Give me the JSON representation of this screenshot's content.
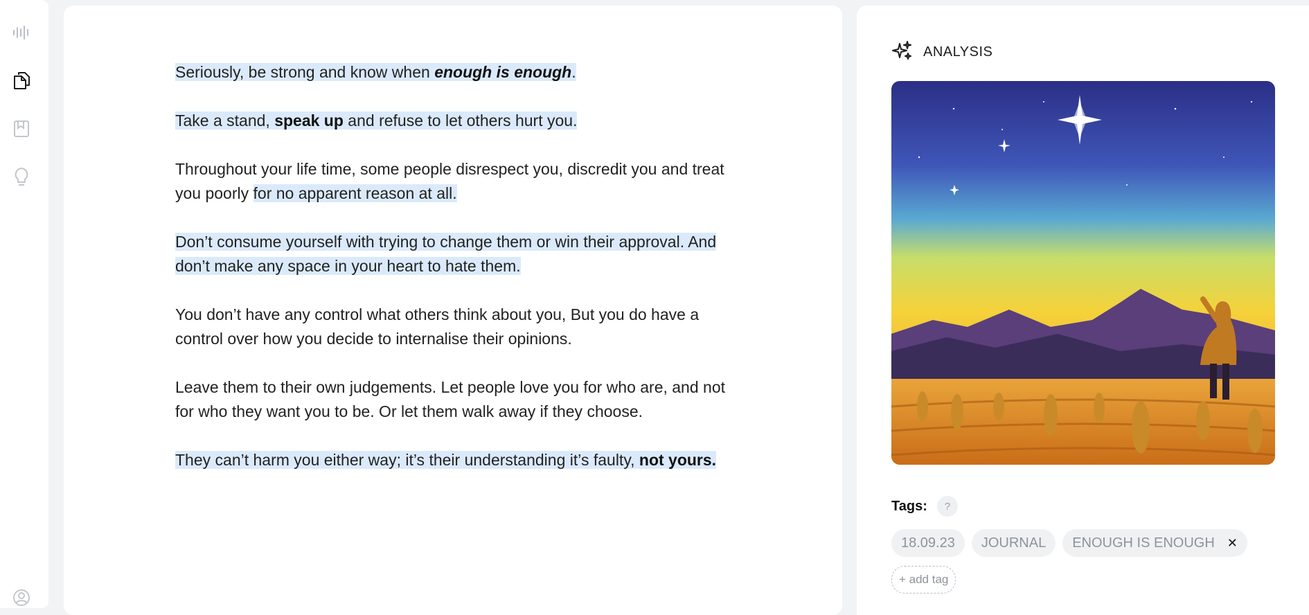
{
  "rail": {
    "icons": [
      "waveform-icon",
      "documents-icon",
      "bookmark-icon",
      "lightbulb-icon",
      "profile-icon"
    ]
  },
  "document": {
    "paragraphs": [
      {
        "highlight": true,
        "segments": [
          {
            "text": "Seriously, be strong and know when ",
            "style": "normal"
          },
          {
            "text": "enough is enough",
            "style": "bold-italic"
          },
          {
            "text": ".",
            "style": "normal"
          }
        ]
      },
      {
        "highlight": true,
        "segments": [
          {
            "text": "Take a stand, ",
            "style": "normal"
          },
          {
            "text": "speak up",
            "style": "bold"
          },
          {
            "text": " and refuse to let others hurt you.",
            "style": "normal"
          }
        ]
      },
      {
        "highlight": false,
        "segments": [
          {
            "text": "Throughout your life time, some people disrespect you, discredit you and treat you poorly ",
            "style": "normal"
          },
          {
            "text": "for no apparent reason at all.",
            "style": "highlight"
          }
        ]
      },
      {
        "highlight": true,
        "segments": [
          {
            "text": "Don’t consume yourself with trying to change them or win their approval. And don’t make any space in your heart to hate them.",
            "style": "normal"
          }
        ]
      },
      {
        "highlight": false,
        "segments": [
          {
            "text": "You don’t have any control what others think about you, But you do have a control over how you decide to internalise their opinions.",
            "style": "normal"
          }
        ]
      },
      {
        "highlight": false,
        "segments": [
          {
            "text": "Leave them to their own judgements. Let people love you for who are, and not for who they want you to be. Or let them walk away if they choose.",
            "style": "normal"
          }
        ]
      },
      {
        "highlight": true,
        "segments": [
          {
            "text": "They can’t harm you either way; it’s their understanding it’s faulty, ",
            "style": "normal"
          },
          {
            "text": "not yours.",
            "style": "bold"
          }
        ]
      }
    ]
  },
  "analysis": {
    "title": "ANALYSIS",
    "icon": "sparkles-icon",
    "image_alt": "illustration-person-watching-star-over-mountains",
    "tags_label": "Tags:",
    "help_label": "?",
    "tags": [
      "18.09.23",
      "JOURNAL",
      "ENOUGH IS ENOUGH"
    ],
    "remove_label": "✕",
    "add_tag_label": "+ add tag"
  },
  "colors": {
    "highlight": "#dbeafb",
    "background": "#f2f3f5",
    "chip": "#f0f1f3"
  }
}
